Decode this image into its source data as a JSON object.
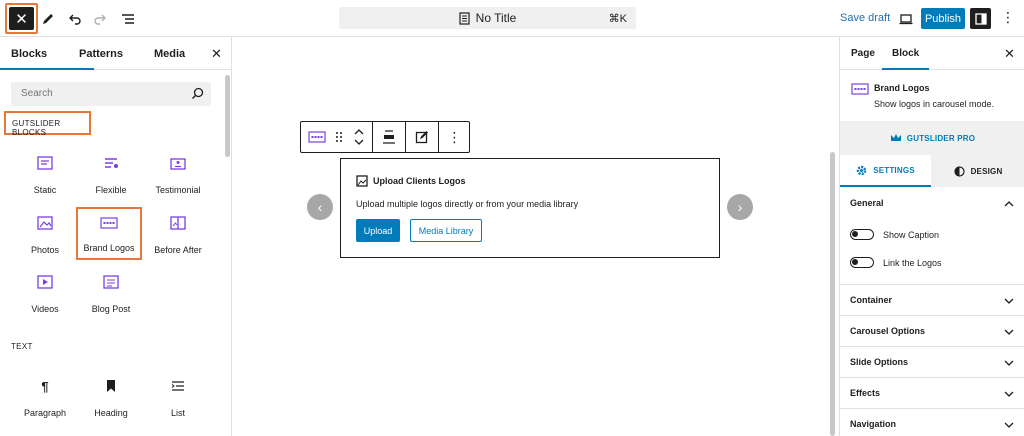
{
  "topbar": {
    "doc_title": "No Title",
    "shortcut": "⌘K",
    "save_draft": "Save draft",
    "publish": "Publish"
  },
  "inserter": {
    "tabs": [
      "Blocks",
      "Patterns",
      "Media"
    ],
    "search_placeholder": "Search",
    "category_gutslider": "GUTSLIDER BLOCKS",
    "category_text": "TEXT",
    "blocks": [
      {
        "label": "Static",
        "icon": "static-slider-icon"
      },
      {
        "label": "Flexible",
        "icon": "flexible-slider-icon"
      },
      {
        "label": "Testimonial",
        "icon": "testimonial-icon"
      },
      {
        "label": "Photos",
        "icon": "photos-icon"
      },
      {
        "label": "Brand Logos",
        "icon": "brand-logos-icon"
      },
      {
        "label": "Before After",
        "icon": "before-after-icon"
      },
      {
        "label": "Videos",
        "icon": "videos-icon"
      },
      {
        "label": "Blog Post",
        "icon": "blog-post-icon"
      }
    ],
    "text_blocks": [
      {
        "label": "Paragraph",
        "icon": "paragraph-icon"
      },
      {
        "label": "Heading",
        "icon": "heading-icon"
      },
      {
        "label": "List",
        "icon": "list-icon"
      }
    ]
  },
  "canvas": {
    "upload_title": "Upload Clients Logos",
    "upload_desc": "Upload multiple logos directly or from your media library",
    "upload_button": "Upload",
    "media_library_button": "Media Library"
  },
  "sidebar": {
    "tabs": [
      "Page",
      "Block"
    ],
    "block_title": "Brand Logos",
    "block_desc": "Show logos in carousel mode.",
    "pro_label": "GUTSLIDER PRO",
    "settings_tab": "SETTINGS",
    "design_tab": "DESIGN",
    "general": "General",
    "toggles": [
      "Show Caption",
      "Link the Logos"
    ],
    "panels": [
      "Container",
      "Carousel Options",
      "Slide Options",
      "Effects",
      "Navigation"
    ]
  },
  "colors": {
    "accent": "#007cba",
    "gutslider": "#7b3fe4",
    "highlight": "#e8773a"
  }
}
